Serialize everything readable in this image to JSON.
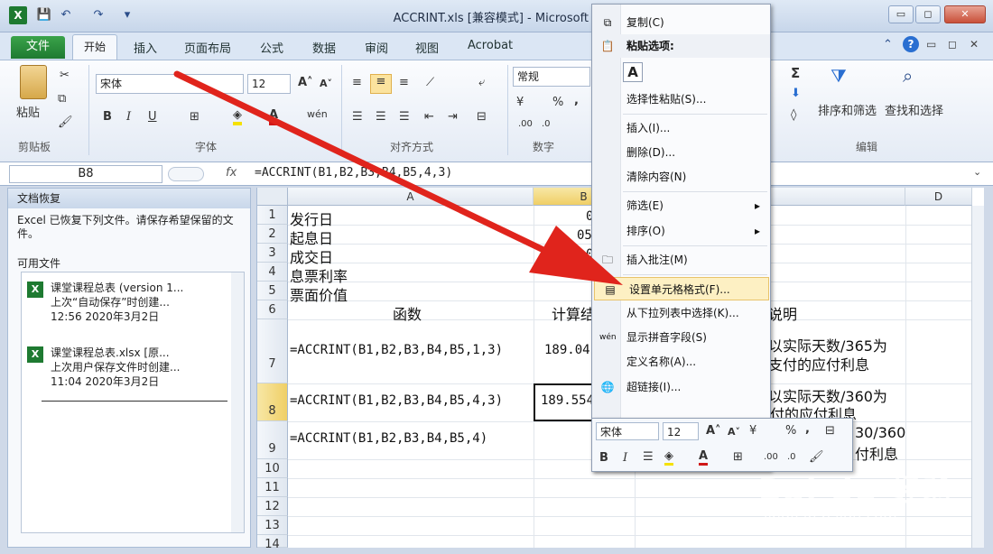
{
  "window": {
    "title": "ACCRINT.xls  [兼容模式] - Microsoft E",
    "controls": [
      "▭",
      "◻",
      "✕"
    ]
  },
  "ribbon": {
    "tabs": [
      "文件",
      "开始",
      "插入",
      "页面布局",
      "公式",
      "数据",
      "审阅",
      "视图",
      "Acrobat"
    ],
    "clipboard": {
      "paste": "粘贴",
      "group": "剪贴板"
    },
    "font": {
      "name": "宋体",
      "size": "12",
      "group": "字体",
      "bold": "B",
      "italic": "I",
      "underline": "U"
    },
    "align": {
      "group": "对齐方式"
    },
    "number": {
      "format": "常规",
      "group": "数字",
      "percent": "%",
      "comma": ","
    },
    "editing": {
      "sort": "排序和筛选",
      "find": "查找和选择",
      "group": "编辑",
      "sigma": "Σ"
    }
  },
  "formula_bar": {
    "name_box": "B8",
    "fx": "fx",
    "formula": "=ACCRINT(B1,B2,B3,B4,B5,4,3)"
  },
  "recovery": {
    "title": "文档恢复",
    "message": "Excel 已恢复下列文件。请保存希望保留的文件。",
    "available": "可用文件",
    "files": [
      {
        "name": "课堂课程总表 (version 1...",
        "desc": "上次“自动保存”时创建...",
        "time": "12:56 2020年3月2日"
      },
      {
        "name": "课堂课程总表.xlsx [原...",
        "desc": "上次用户保存文件时创建...",
        "time": "11:04 2020年3月2日"
      }
    ]
  },
  "sheet": {
    "columns": [
      "A",
      "B",
      "D"
    ],
    "rows": [
      "1",
      "2",
      "3",
      "4",
      "5",
      "6",
      "7",
      "8",
      "9",
      "10",
      "11",
      "12",
      "13",
      "14"
    ],
    "col_a": [
      "发行日",
      "起息日",
      "成交日",
      "息票利率",
      "票面价值",
      "函数",
      "=ACCRINT(B1,B2,B3,B4,B5,1,3)",
      "=ACCRINT(B1,B2,B3,B4,B5,4,3)",
      "=ACCRINT(B1,B2,B3,B4,B5,4)"
    ],
    "col_b": [
      "0",
      "05",
      "0",
      "",
      "",
      "计算结",
      "189.04",
      "189.5547945"
    ],
    "col_c": [
      "说明",
      "以实际天数/365为",
      "支付的应付利息",
      "以实际天数/360为",
      "日计数基准，按季支付的应付利息",
      "30/360",
      "付利息"
    ]
  },
  "context_menu": {
    "items": [
      "复制(C)",
      "粘贴选项:",
      "选择性粘贴(S)...",
      "插入(I)...",
      "删除(D)...",
      "清除内容(N)",
      "筛选(E)",
      "排序(O)",
      "插入批注(M)",
      "设置单元格格式(F)...",
      "从下拉列表中选择(K)...",
      "显示拼音字段(S)",
      "定义名称(A)...",
      "超链接(I)..."
    ],
    "paste_icon": "A"
  },
  "mini_toolbar": {
    "font": "宋体",
    "size": "12",
    "bold": "B",
    "italic": "I",
    "percent": "%",
    "comma": ","
  },
  "watermark": {
    "text": "Bai du 经验",
    "url": "jingyan.baidu.com"
  }
}
